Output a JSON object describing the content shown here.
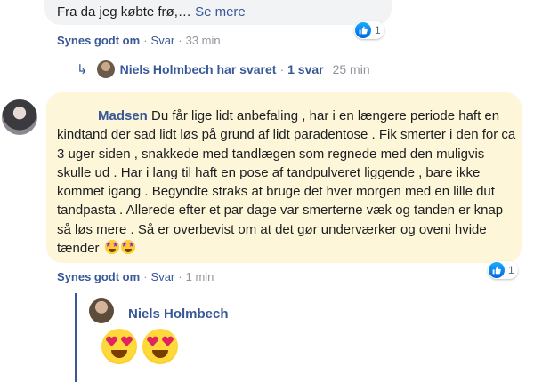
{
  "top_comment": {
    "text": "Fra da jeg købte frø,…",
    "see_more": "Se mere",
    "actions": {
      "like": "Synes godt om",
      "reply": "Svar",
      "time": "33 min"
    },
    "reaction_count": "1"
  },
  "reply_summary": {
    "text": "Niels Holmbech har svaret",
    "count": "1 svar",
    "time": "25 min"
  },
  "main_comment": {
    "author": "Madsen",
    "text": "Du får lige lidt anbefaling , har i en længere periode haft en kindtand der sad lidt løs på grund af lidt paradentose . Fik smerter i den for ca 3 uger siden , snakkede med tandlægen som regnede med den muligvis skulle ud . Har i lang til haft en pose af tandpulveret liggende , bare ikke kommet igang . Begyndte straks at bruge det hver morgen med en lille dut tandpasta . Allerede efter et par dage var smerterne væk og tanden er knap så løs mere . Så er overbevist om at det gør underværker og oveni hvide tænder",
    "actions": {
      "like": "Synes godt om",
      "reply": "Svar",
      "time": "1 min"
    },
    "reaction_count": "1"
  },
  "reply": {
    "author": "Niels Holmbech"
  },
  "icons": {
    "like": "like-icon",
    "reply_arrow": "reply-arrow-icon",
    "star_struck": "star-struck-emoji",
    "heart_eyes": "heart-eyes-emoji"
  },
  "colors": {
    "link": "#385898",
    "highlight_bubble": "#fdf6d8",
    "bubble_grey": "#f2f3f5",
    "muted": "#90949c"
  }
}
